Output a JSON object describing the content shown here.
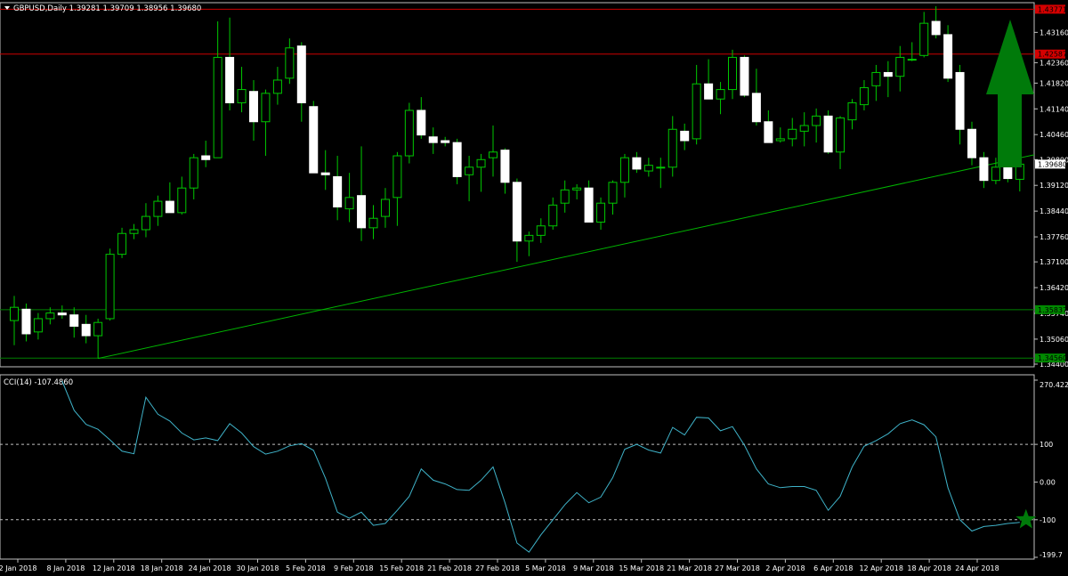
{
  "header": {
    "main_title": "GBPUSD,Daily  1.39281 1.39709 1.38956 1.39680",
    "indicator_title": "CCI(14) -107.4860"
  },
  "colors": {
    "background": "#000000",
    "frame": "#c0c0c0",
    "candle_bull_fill": "#000000",
    "candle_bear_fill": "#ffffff",
    "wick": "#00c800",
    "resistance_line": "#cc0000",
    "support_line": "#008000",
    "trendline": "#00b400",
    "cci_line": "#3fb3c9",
    "arrow": "#007a0a",
    "star": "#007a0a"
  },
  "price_axis": {
    "ticks": [
      "1.43160",
      "1.42360",
      "1.41820",
      "1.41140",
      "1.40460",
      "1.39800",
      "1.39120",
      "1.38440",
      "1.37760",
      "1.37100",
      "1.36420",
      "1.35740",
      "1.35060",
      "1.34400"
    ],
    "current_price_label": "1.39680",
    "level_labels": [
      {
        "text": "1.43771",
        "kind": "resistance"
      },
      {
        "text": "1.42587",
        "kind": "resistance"
      },
      {
        "text": "1.35837",
        "kind": "support"
      },
      {
        "text": "1.34560",
        "kind": "support"
      }
    ]
  },
  "cci_axis": {
    "ticks": [
      "270.4223",
      "100",
      "0.00",
      "-100",
      "-199.7"
    ]
  },
  "time_axis": {
    "ticks": [
      "2 Jan 2018",
      "8 Jan 2018",
      "12 Jan 2018",
      "18 Jan 2018",
      "24 Jan 2018",
      "30 Jan 2018",
      "5 Feb 2018",
      "9 Feb 2018",
      "15 Feb 2018",
      "21 Feb 2018",
      "27 Feb 2018",
      "5 Mar 2018",
      "9 Mar 2018",
      "15 Mar 2018",
      "21 Mar 2018",
      "27 Mar 2018",
      "2 Apr 2018",
      "6 Apr 2018",
      "12 Apr 2018",
      "18 Apr 2018",
      "24 Apr 2018"
    ]
  },
  "chart_data": {
    "type": "candlestick",
    "symbol": "GBPUSD",
    "timeframe": "Daily",
    "ylim": [
      1.344,
      1.4385
    ],
    "horizontal_levels": [
      1.43771,
      1.42587,
      1.35837,
      1.3456
    ],
    "trendline": {
      "from_bar": 7,
      "from_price": 1.3455,
      "to_bar": 87,
      "to_price": 1.4005
    },
    "candles": [
      [
        1.3555,
        1.362,
        1.349,
        1.359
      ],
      [
        1.3585,
        1.36,
        1.35,
        1.352
      ],
      [
        1.3525,
        1.3575,
        1.3505,
        1.356
      ],
      [
        1.356,
        1.359,
        1.3545,
        1.3575
      ],
      [
        1.3575,
        1.3595,
        1.356,
        1.357
      ],
      [
        1.357,
        1.359,
        1.351,
        1.354
      ],
      [
        1.3545,
        1.357,
        1.3495,
        1.3515
      ],
      [
        1.3515,
        1.356,
        1.3455,
        1.355
      ],
      [
        1.356,
        1.3745,
        1.3555,
        1.373
      ],
      [
        1.373,
        1.38,
        1.372,
        1.3785
      ],
      [
        1.3785,
        1.381,
        1.377,
        1.3795
      ],
      [
        1.3795,
        1.3865,
        1.3775,
        1.383
      ],
      [
        1.383,
        1.3885,
        1.3805,
        1.387
      ],
      [
        1.387,
        1.392,
        1.3845,
        1.384
      ],
      [
        1.384,
        1.3935,
        1.3835,
        1.3905
      ],
      [
        1.3905,
        1.3995,
        1.3875,
        1.3985
      ],
      [
        1.399,
        1.403,
        1.396,
        1.398
      ],
      [
        1.3985,
        1.4345,
        1.3985,
        1.425
      ],
      [
        1.425,
        1.4355,
        1.411,
        1.413
      ],
      [
        1.413,
        1.4225,
        1.4105,
        1.4165
      ],
      [
        1.416,
        1.419,
        1.403,
        1.408
      ],
      [
        1.408,
        1.4165,
        1.399,
        1.4155
      ],
      [
        1.4155,
        1.4225,
        1.4125,
        1.419
      ],
      [
        1.4195,
        1.43,
        1.418,
        1.4275
      ],
      [
        1.428,
        1.429,
        1.408,
        1.413
      ],
      [
        1.412,
        1.4135,
        1.3945,
        1.3945
      ],
      [
        1.3945,
        1.4005,
        1.39,
        1.394
      ],
      [
        1.3935,
        1.399,
        1.382,
        1.3855
      ],
      [
        1.385,
        1.3945,
        1.3815,
        1.388
      ],
      [
        1.3885,
        1.4015,
        1.3765,
        1.38
      ],
      [
        1.38,
        1.386,
        1.377,
        1.3825
      ],
      [
        1.383,
        1.3905,
        1.38,
        1.3875
      ],
      [
        1.388,
        1.4,
        1.3805,
        1.399
      ],
      [
        1.399,
        1.413,
        1.397,
        1.411
      ],
      [
        1.411,
        1.4145,
        1.4035,
        1.4045
      ],
      [
        1.404,
        1.4065,
        1.3995,
        1.4025
      ],
      [
        1.403,
        1.404,
        1.4015,
        1.4025
      ],
      [
        1.4025,
        1.4035,
        1.3915,
        1.3935
      ],
      [
        1.394,
        1.399,
        1.387,
        1.396
      ],
      [
        1.396,
        1.3995,
        1.3895,
        1.398
      ],
      [
        1.3985,
        1.407,
        1.3935,
        1.4
      ],
      [
        1.4005,
        1.401,
        1.389,
        1.392
      ],
      [
        1.392,
        1.393,
        1.371,
        1.3765
      ],
      [
        1.3765,
        1.379,
        1.3725,
        1.378
      ],
      [
        1.378,
        1.3825,
        1.376,
        1.3805
      ],
      [
        1.3805,
        1.388,
        1.3795,
        1.386
      ],
      [
        1.3865,
        1.3925,
        1.384,
        1.39
      ],
      [
        1.39,
        1.3915,
        1.3875,
        1.3905
      ],
      [
        1.3905,
        1.3925,
        1.3815,
        1.3815
      ],
      [
        1.3815,
        1.388,
        1.3795,
        1.3865
      ],
      [
        1.3865,
        1.3925,
        1.3835,
        1.392
      ],
      [
        1.392,
        1.3995,
        1.388,
        1.3985
      ],
      [
        1.3985,
        1.4,
        1.3945,
        1.3955
      ],
      [
        1.395,
        1.3985,
        1.3935,
        1.3965
      ],
      [
        1.396,
        1.3985,
        1.3905,
        1.396
      ],
      [
        1.396,
        1.4095,
        1.3935,
        1.406
      ],
      [
        1.4055,
        1.4075,
        1.4005,
        1.403
      ],
      [
        1.4035,
        1.423,
        1.402,
        1.418
      ],
      [
        1.418,
        1.4245,
        1.415,
        1.414
      ],
      [
        1.414,
        1.4185,
        1.41,
        1.4165
      ],
      [
        1.4165,
        1.427,
        1.414,
        1.425
      ],
      [
        1.425,
        1.4255,
        1.4145,
        1.415
      ],
      [
        1.4155,
        1.422,
        1.407,
        1.408
      ],
      [
        1.408,
        1.411,
        1.4025,
        1.4025
      ],
      [
        1.403,
        1.4065,
        1.4025,
        1.4035
      ],
      [
        1.4035,
        1.409,
        1.4015,
        1.406
      ],
      [
        1.4055,
        1.4105,
        1.4015,
        1.407
      ],
      [
        1.407,
        1.4115,
        1.4025,
        1.4095
      ],
      [
        1.4095,
        1.411,
        1.3995,
        1.4
      ],
      [
        1.4,
        1.4095,
        1.3955,
        1.409
      ],
      [
        1.4085,
        1.414,
        1.406,
        1.413
      ],
      [
        1.4125,
        1.419,
        1.411,
        1.417
      ],
      [
        1.4175,
        1.423,
        1.4135,
        1.421
      ],
      [
        1.421,
        1.424,
        1.4145,
        1.42
      ],
      [
        1.42,
        1.428,
        1.416,
        1.425
      ],
      [
        1.4245,
        1.429,
        1.424,
        1.4245
      ],
      [
        1.4255,
        1.437,
        1.425,
        1.434
      ],
      [
        1.4345,
        1.4385,
        1.43,
        1.431
      ],
      [
        1.431,
        1.4335,
        1.4185,
        1.4195
      ],
      [
        1.421,
        1.423,
        1.402,
        1.406
      ],
      [
        1.406,
        1.408,
        1.3965,
        1.3985
      ],
      [
        1.3985,
        1.4,
        1.3905,
        1.3925
      ],
      [
        1.3925,
        1.3985,
        1.3915,
        1.396
      ],
      [
        1.396,
        1.399,
        1.392,
        1.393
      ],
      [
        1.3928,
        1.3971,
        1.3896,
        1.3968
      ]
    ],
    "cci": {
      "name": "CCI(14)",
      "last_value": -107.486,
      "ylim": [
        -199.7,
        270.4223
      ],
      "values": [
        268,
        190,
        153,
        140,
        112,
        82,
        75,
        225,
        180,
        162,
        130,
        112,
        117,
        110,
        155,
        130,
        94,
        74,
        82,
        96,
        102,
        84,
        10,
        -80,
        -96,
        -80,
        -115,
        -110,
        -75,
        -38,
        35,
        5,
        -5,
        -20,
        -22,
        5,
        40,
        -55,
        -162,
        -186,
        -140,
        -100,
        -60,
        -28,
        -55,
        -40,
        12,
        87,
        100,
        85,
        77,
        145,
        125,
        172,
        170,
        136,
        147,
        98,
        35,
        -5,
        -15,
        -12,
        -12,
        -22,
        -75,
        -38,
        40,
        95,
        110,
        128,
        155,
        165,
        152,
        120,
        -15,
        -100,
        -130,
        -118,
        -115,
        -110,
        -107
      ]
    }
  }
}
